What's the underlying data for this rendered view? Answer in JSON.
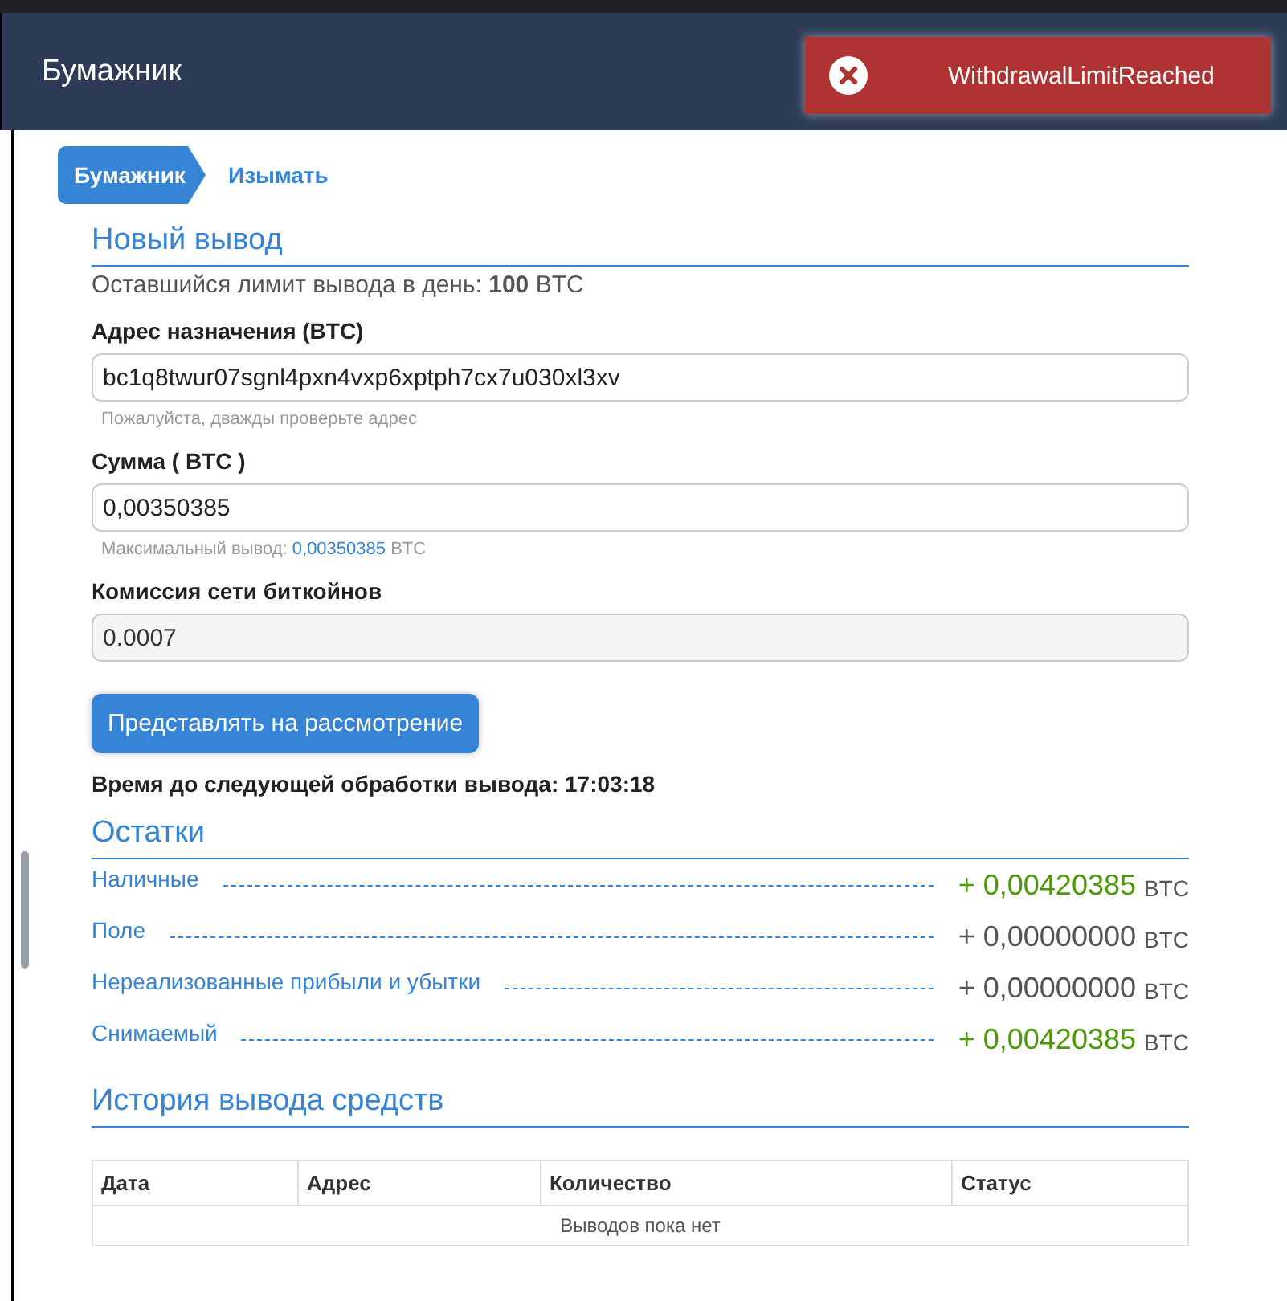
{
  "header": {
    "title": "Бумажник"
  },
  "toast": {
    "message": "WithdrawalLimitReached"
  },
  "breadcrumbs": [
    {
      "label": "Бумажник",
      "selected": true
    },
    {
      "label": "Изымать",
      "selected": false
    }
  ],
  "new_withdrawal": {
    "title": "Новый вывод",
    "limit_text": "Оставшийся лимит вывода в день: **100** BTC",
    "fields": [
      {
        "label": "Адрес назначения (BTC)",
        "value": "bc1q8twur07sgnl4pxn4vxp6xptph7cx7u030xl3xv",
        "hint": "Пожалуйста, дважды проверьте адрес",
        "disabled": false
      },
      {
        "label": "Сумма ( BTC )",
        "value": "0,00350385",
        "hint_prefix": "Максимальный вывод:",
        "hint_link": "0,00350385",
        "hint_suffix": "BTC",
        "disabled": false
      },
      {
        "label": "Комиссия сети биткойнов",
        "value": "0.0007",
        "disabled": true
      }
    ],
    "submit_button": "Представлять на рассмотрение",
    "next_processing": "Время до следующей обработки вывода: 17:03:18"
  },
  "balances": {
    "title": "Остатки",
    "items": [
      {
        "label": "Наличные",
        "amount": "+ 0,00420385",
        "unit": "BTC",
        "color": "#4e9a06"
      },
      {
        "label": "Поле",
        "amount": "+ 0,00000000",
        "unit": "BTC",
        "color": "#555555"
      },
      {
        "label": "Нереализованные прибыли и убытки",
        "amount": "+ 0,00000000",
        "unit": "BTC",
        "color": "#555555"
      },
      {
        "label": "Снимаемый",
        "amount": "+ 0,00420385",
        "unit": "BTC",
        "color": "#4e9a06"
      }
    ]
  },
  "history": {
    "title": "История вывода средств",
    "columns": [
      "Дата",
      "Адрес",
      "Количество",
      "Статус"
    ],
    "empty_text": "Выводов пока нет"
  }
}
